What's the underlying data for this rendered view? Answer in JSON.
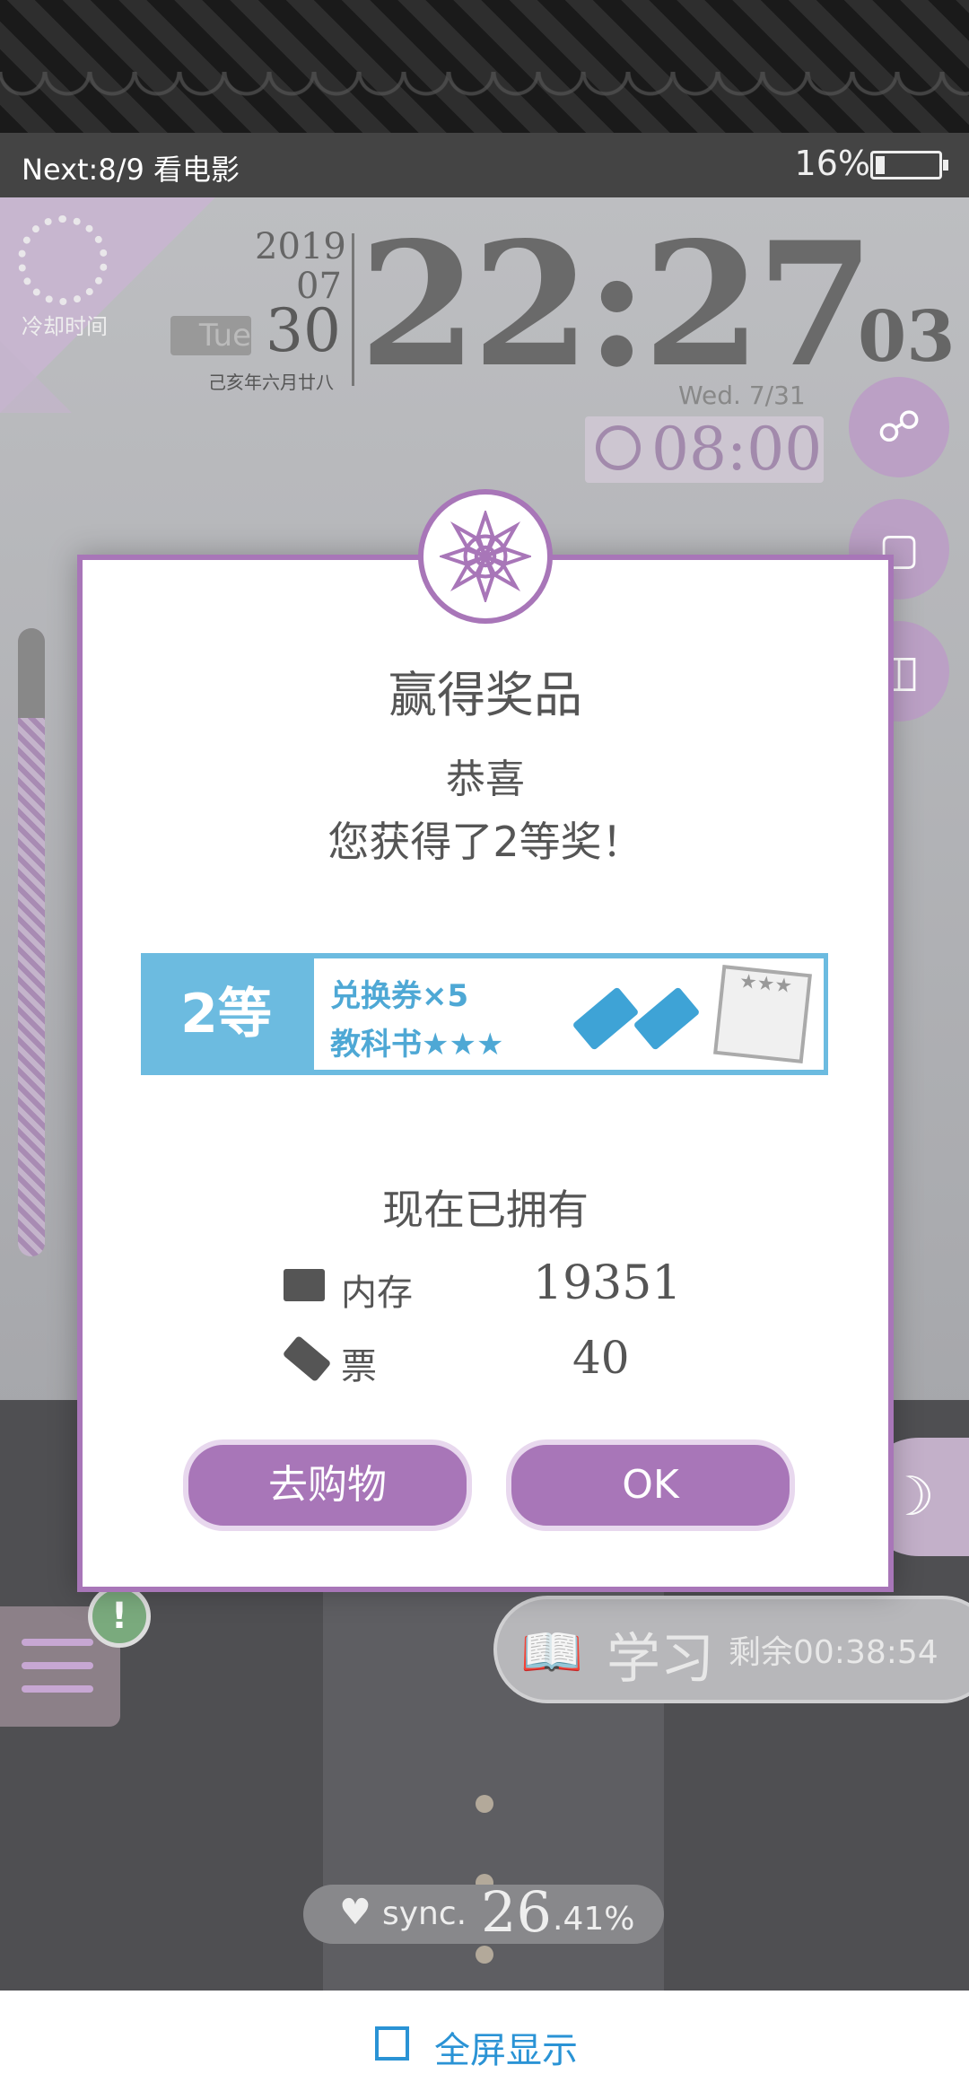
{
  "status_bar": {
    "next_event": "Next:8/9 看电影",
    "battery_percent": "16%",
    "battery_level": 0.16
  },
  "clock": {
    "year": "2019",
    "month": "07",
    "day": "30",
    "weekday_short": "Tue",
    "lunar_date": "己亥年六月廿八",
    "time": "22:27",
    "seconds": "03",
    "date_line": "Wed.  7/31",
    "alarm_time": "08:00"
  },
  "cooldown_label": "冷却时间",
  "study": {
    "label": "学习",
    "remaining": "剩余00:38:54"
  },
  "sync": {
    "label": "sync.",
    "int": "26",
    "decimal": ".41%"
  },
  "bottom_bar": {
    "fullscreen_label": "全屏显示"
  },
  "dialog": {
    "title": "赢得奖品",
    "congrats": "恭喜",
    "message": "您获得了2等奖！",
    "prize": {
      "rank": "2等",
      "line1": "兑换券×5",
      "line2": "教科书★★★"
    },
    "owned": {
      "title": "现在已拥有",
      "memory_label": "内存",
      "memory_value": "19351",
      "ticket_label": "票",
      "ticket_value": "40"
    },
    "buttons": {
      "shop": "去购物",
      "ok": "OK"
    }
  },
  "colors": {
    "accent_purple": "#a876b8",
    "prize_blue": "#6cbbe0",
    "link_blue": "#2a93d5"
  },
  "icons": [
    "share-icon",
    "book-icon",
    "gift-icon",
    "menu-icon",
    "alert-icon",
    "moon-icon",
    "alarm-icon",
    "heart-icon",
    "fullscreen-icon"
  ]
}
